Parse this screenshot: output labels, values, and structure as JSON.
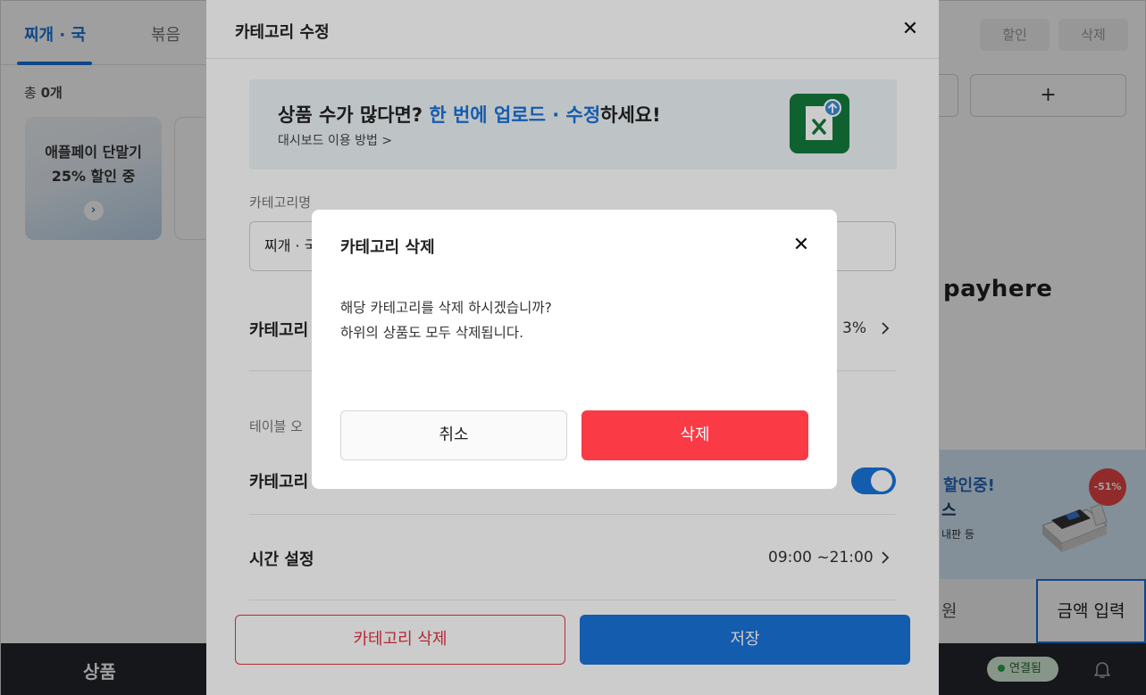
{
  "background": {
    "tabs": [
      "찌개 · 국",
      "볶음"
    ],
    "count_prefix": "총 ",
    "count_value": "0개",
    "promo_line1": "애플페이 단말기",
    "promo_line2": "25% 할인 중",
    "top_buttons": {
      "discount": "할인",
      "delete": "삭제"
    },
    "add_symbol": "+",
    "logo_text": "payhere",
    "ad": {
      "title": "할인중!",
      "sub1": "스",
      "sub2": "내판 등",
      "badge": "-51%"
    },
    "won_text": "원",
    "amount_button": "금액 입력",
    "bottom_label": "상품",
    "connection_status": "연결됨"
  },
  "panel": {
    "title": "카테고리 수정",
    "banner": {
      "title_pre": "상품 수가 많다면? ",
      "title_highlight": "한 번에 업로드 · 수정",
      "title_post": "하세요!",
      "link": "대시보드 이용 방법 >"
    },
    "name_label": "카테고리명",
    "name_value": "찌개 · 국",
    "discount_row_label": "카테고리",
    "discount_row_value": "3%",
    "table_order_label": "테이블 오",
    "visibility_row_label": "카테고리",
    "time_row_label": "시간 설정",
    "time_row_value": "09:00 ~21:00",
    "delete_button": "카테고리 삭제",
    "save_button": "저장"
  },
  "dialog": {
    "title": "카테고리 삭제",
    "message_line1": "해당 카테고리를 삭제 하시겠습니까?",
    "message_line2": "하위의 상품도 모두 삭제됩니다.",
    "cancel_button": "취소",
    "confirm_button": "삭제"
  },
  "colors": {
    "accent": "#1a73d9",
    "danger": "#fa3a45",
    "excel_green": "#157a3c",
    "bottom_bar": "#23262c"
  },
  "icons": {
    "close": "close-icon",
    "chevron": "chevron-right-icon",
    "excel": "excel-upload-icon",
    "bell": "bell-icon"
  }
}
